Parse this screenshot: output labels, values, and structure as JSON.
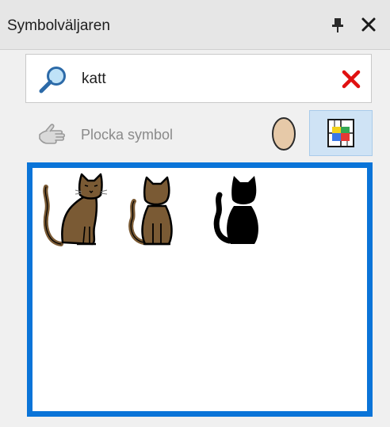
{
  "window": {
    "title": "Symbolväljaren"
  },
  "icons": {
    "pin": "pin-icon",
    "close": "close-icon",
    "search": "search-icon",
    "clear": "clear-x-icon",
    "pick": "hand-pointer-icon",
    "skin": "skin-tone-icon",
    "grid": "color-grid-icon"
  },
  "search": {
    "value": "katt",
    "placeholder": ""
  },
  "toolbar": {
    "pick_label": "Plocka symbol"
  },
  "results": {
    "items": [
      {
        "name": "cat-symbol-sitting",
        "color": "#7a5a34"
      },
      {
        "name": "cat-symbol-front",
        "color": "#7a5a34"
      },
      {
        "name": "cat-symbol-silhouette",
        "color": "#000000"
      }
    ]
  },
  "colors": {
    "accent": "#0a74d8",
    "clear": "#e01010",
    "cat_brown": "#7a5a34",
    "skin": "#e6c9a8"
  }
}
